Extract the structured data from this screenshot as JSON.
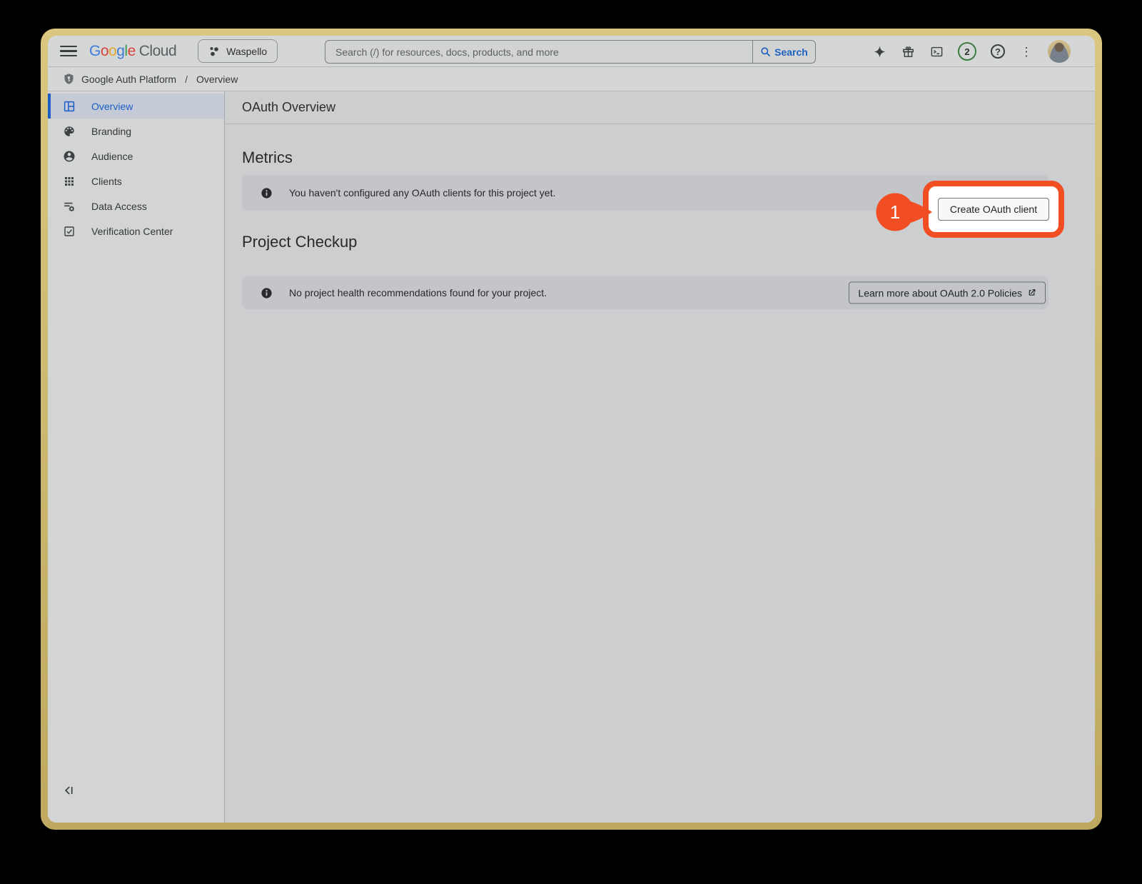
{
  "topbar": {
    "logo": {
      "letters": [
        "G",
        "o",
        "o",
        "g",
        "l",
        "e"
      ],
      "cloud": "Cloud"
    },
    "project_selector": {
      "label": "Waspello"
    },
    "search": {
      "placeholder": "Search (/) for resources, docs, products, and more",
      "button_label": "Search"
    },
    "notifications": {
      "count": "2"
    },
    "help_glyph": "?",
    "more_glyph": "⋮"
  },
  "breadcrumb": {
    "platform": "Google Auth Platform",
    "separator": "/",
    "page": "Overview"
  },
  "sidebar": {
    "items": [
      {
        "label": "Overview",
        "icon": "dashboard-icon",
        "active": true
      },
      {
        "label": "Branding",
        "icon": "palette-icon",
        "active": false
      },
      {
        "label": "Audience",
        "icon": "person-icon",
        "active": false
      },
      {
        "label": "Clients",
        "icon": "apps-grid-icon",
        "active": false
      },
      {
        "label": "Data Access",
        "icon": "list-settings-icon",
        "active": false
      },
      {
        "label": "Verification Center",
        "icon": "checkbox-icon",
        "active": false
      }
    ]
  },
  "main": {
    "page_title": "OAuth Overview",
    "metrics": {
      "heading": "Metrics",
      "info_text": "You haven't configured any OAuth clients for this project yet.",
      "create_button_label": "Create OAuth client"
    },
    "project_checkup": {
      "heading": "Project Checkup",
      "info_text": "No project health recommendations found for your project.",
      "learn_more_label": "Learn more about OAuth 2.0 Policies"
    }
  },
  "annotation": {
    "step": "1",
    "highlight_color": "#f14e23"
  },
  "colors": {
    "accent_blue": "#1b5fc6",
    "annotation_red": "#f14e23",
    "badge_green": "#3e7d42",
    "frame_tan": "#d2bc74",
    "banner_gray": "#c3c5c9"
  }
}
